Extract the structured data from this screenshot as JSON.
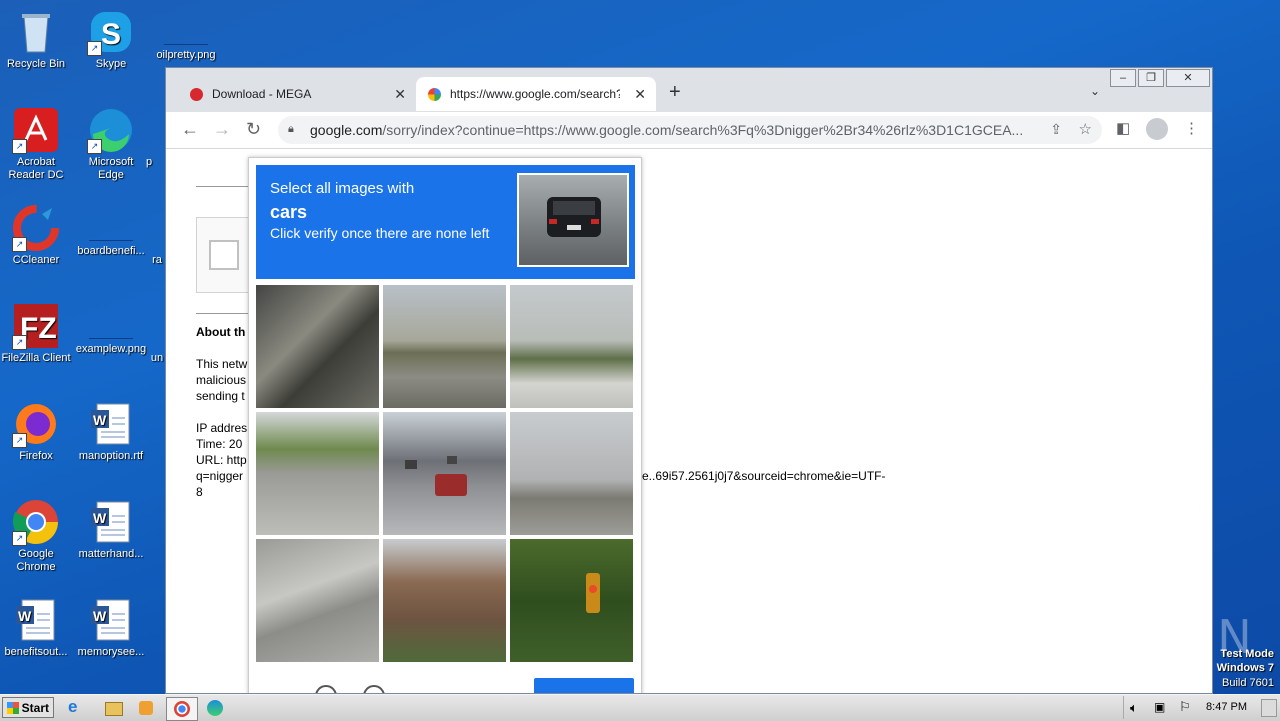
{
  "desktop": {
    "icons": [
      {
        "label": "Recycle Bin"
      },
      {
        "label": "Skype"
      },
      {
        "label": "oilpretty.png"
      },
      {
        "label": "Acrobat Reader DC"
      },
      {
        "label": "Microsoft Edge"
      },
      {
        "label": "p"
      },
      {
        "label": "CCleaner"
      },
      {
        "label": "boardbenefi..."
      },
      {
        "label": "ra"
      },
      {
        "label": "FileZilla Client"
      },
      {
        "label": "examplew.png"
      },
      {
        "label": "un"
      },
      {
        "label": "Firefox"
      },
      {
        "label": "manoption.rtf"
      },
      {
        "label": "Google Chrome"
      },
      {
        "label": "matterhand..."
      },
      {
        "label": "benefitsout..."
      },
      {
        "label": "memorysee..."
      }
    ]
  },
  "browser": {
    "tabs": [
      {
        "label": "Download - MEGA",
        "icon": "mega-icon"
      },
      {
        "label": "https://www.google.com/search?q=",
        "icon": "google-icon"
      }
    ],
    "new_tab": "+",
    "address": {
      "domain": "google.com",
      "path": "/sorry/index?continue=https://www.google.com/search%3Fq%3Dnigger%2Br34%26rlz%3D1C1GCEA..."
    }
  },
  "page": {
    "about_heading": "About th",
    "para_lines": [
      "This netw",
      "malicious",
      "sending t"
    ],
    "ip_line": "IP addres",
    "time_line": "Time: 20",
    "url_line": "URL: http",
    "q_line": "q=nigger",
    "url_tail": "e..69i57.2561j0j7&sourceid=chrome&ie=UTF-",
    "url_tail2": "8"
  },
  "recaptcha": {
    "line1": "Select all images with",
    "target": "cars",
    "line3": "Click verify once there are none left"
  },
  "taskbar": {
    "start": "Start",
    "clock": "8:47 PM"
  },
  "watermark": {
    "line1": "Test Mode",
    "line2": "Windows 7",
    "line3": "Build 7601",
    "brand": "ANY RUN"
  }
}
